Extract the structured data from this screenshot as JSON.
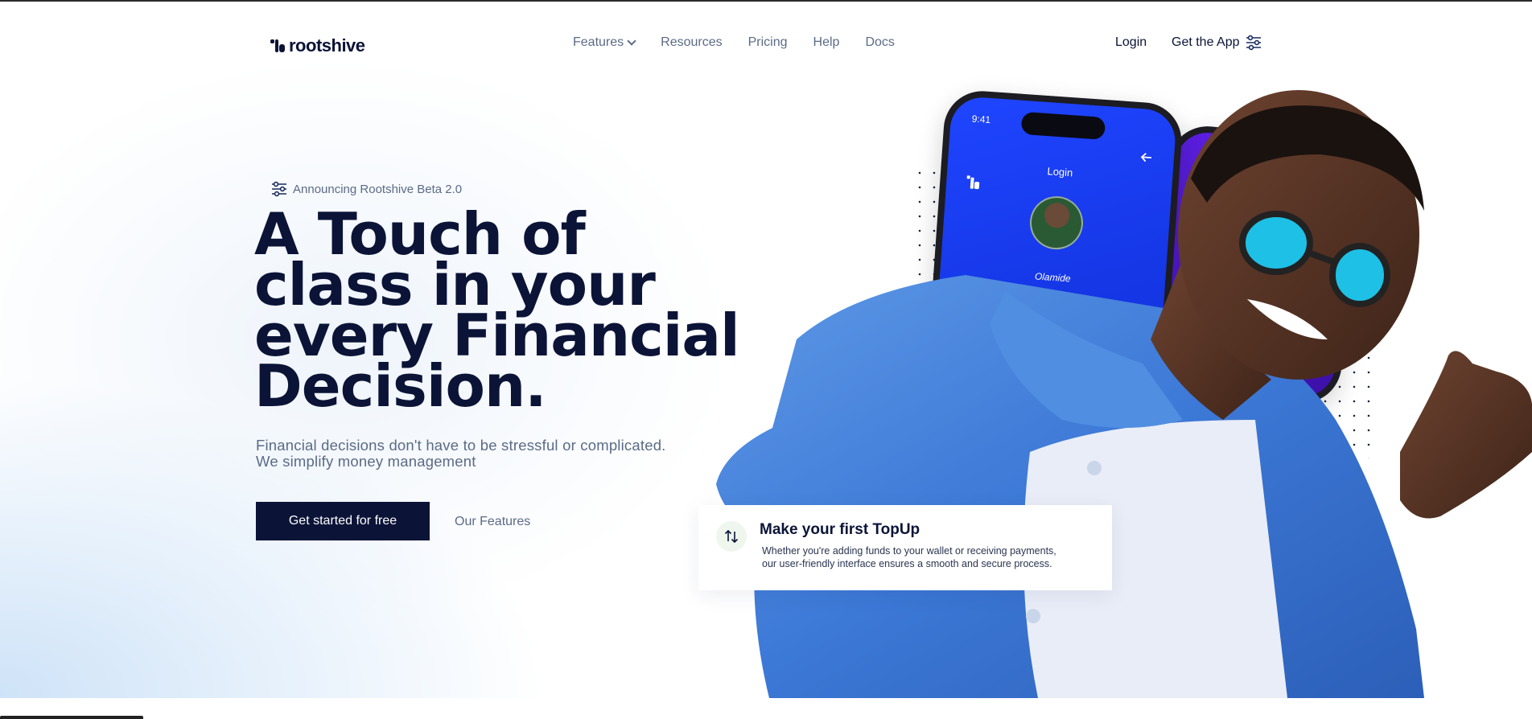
{
  "brand": {
    "name": "rootshive"
  },
  "nav": {
    "items": [
      {
        "label": "Features",
        "has_dropdown": true
      },
      {
        "label": "Resources"
      },
      {
        "label": "Pricing"
      },
      {
        "label": "Help"
      },
      {
        "label": "Docs"
      }
    ],
    "login": "Login",
    "get_app": "Get the App"
  },
  "hero": {
    "announcement": "Announcing Rootshive Beta 2.0",
    "headline": [
      "A Touch of",
      "class in your",
      "every Financial",
      "Decision."
    ],
    "subtext": [
      "Financial decisions don't have to be stressful or complicated.",
      "We simplify money management"
    ],
    "cta_primary": "Get started for free",
    "cta_secondary": "Our Features"
  },
  "phone": {
    "time": "9:41",
    "screen_title": "Login",
    "user_name": "Olamide"
  },
  "topup_card": {
    "icon": "swap-vertical-icon",
    "title": "Make your first TopUp",
    "body": [
      "Whether you're adding funds to your wallet or receiving payments,",
      "our user-friendly interface ensures a smooth and secure process."
    ]
  },
  "colors": {
    "primary": "#0b1437",
    "muted": "#5b6b86",
    "phone_blue": "#1f45ff",
    "shirt_blue": "#3e7ed8",
    "lens_cyan": "#1ec0e6"
  }
}
